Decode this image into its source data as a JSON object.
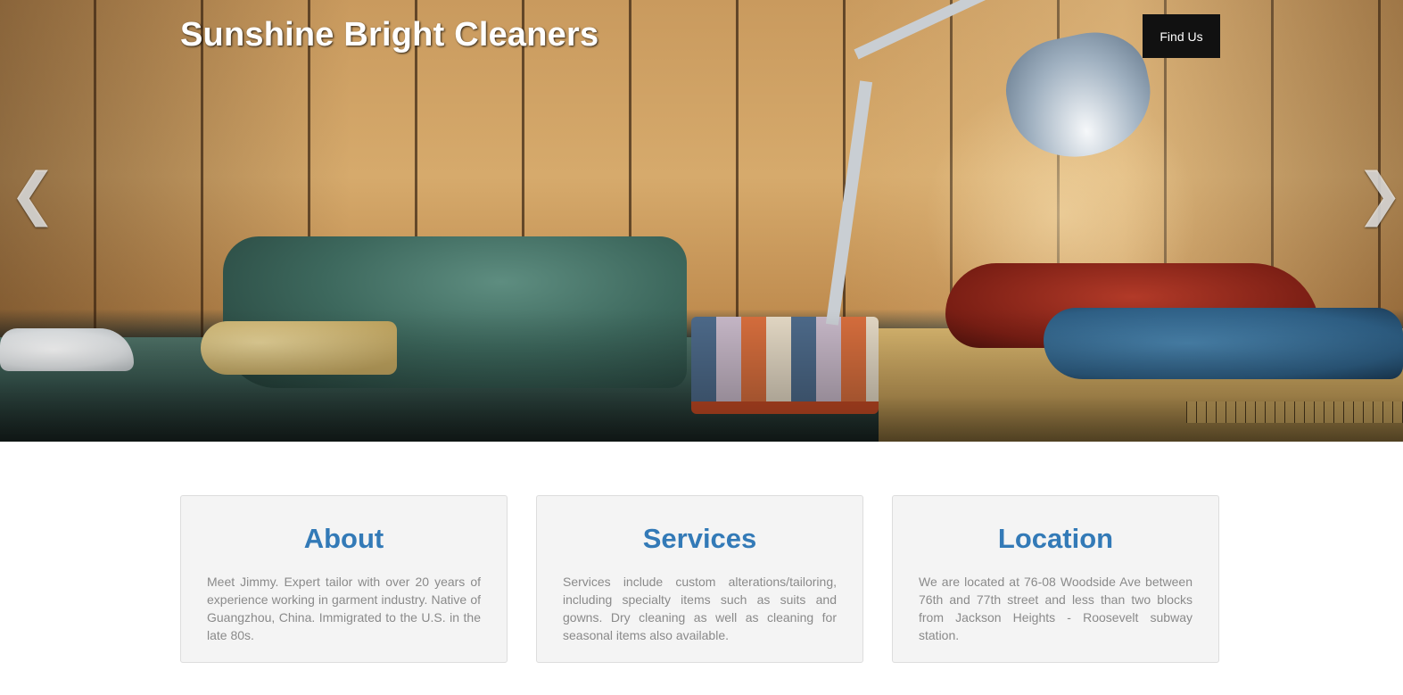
{
  "header": {
    "brand_title": "Sunshine Bright Cleaners",
    "find_us_label": "Find Us"
  },
  "carousel": {
    "prev_glyph": "❮",
    "next_glyph": "❯",
    "image_description_icon": "hero-photo-sewing-workshop"
  },
  "cards": [
    {
      "title": "About",
      "body": "Meet Jimmy. Expert tailor with over 20 years of experience working in garment industry. Native of Guangzhou, China. Immigrated to the U.S. in the late 80s."
    },
    {
      "title": "Services",
      "body": "Services include custom alterations/tailoring, including specialty items such as suits and gowns. Dry cleaning as well as cleaning for seasonal items also available."
    },
    {
      "title": "Location",
      "body": "We are located at 76-08 Woodside Ave between 76th and 77th street and less than two blocks from Jackson Heights - Roosevelt subway station."
    }
  ],
  "colors": {
    "accent": "#337ab7",
    "button_bg": "#111111",
    "card_bg": "#f4f4f4",
    "body_text": "#8a8a8a"
  }
}
